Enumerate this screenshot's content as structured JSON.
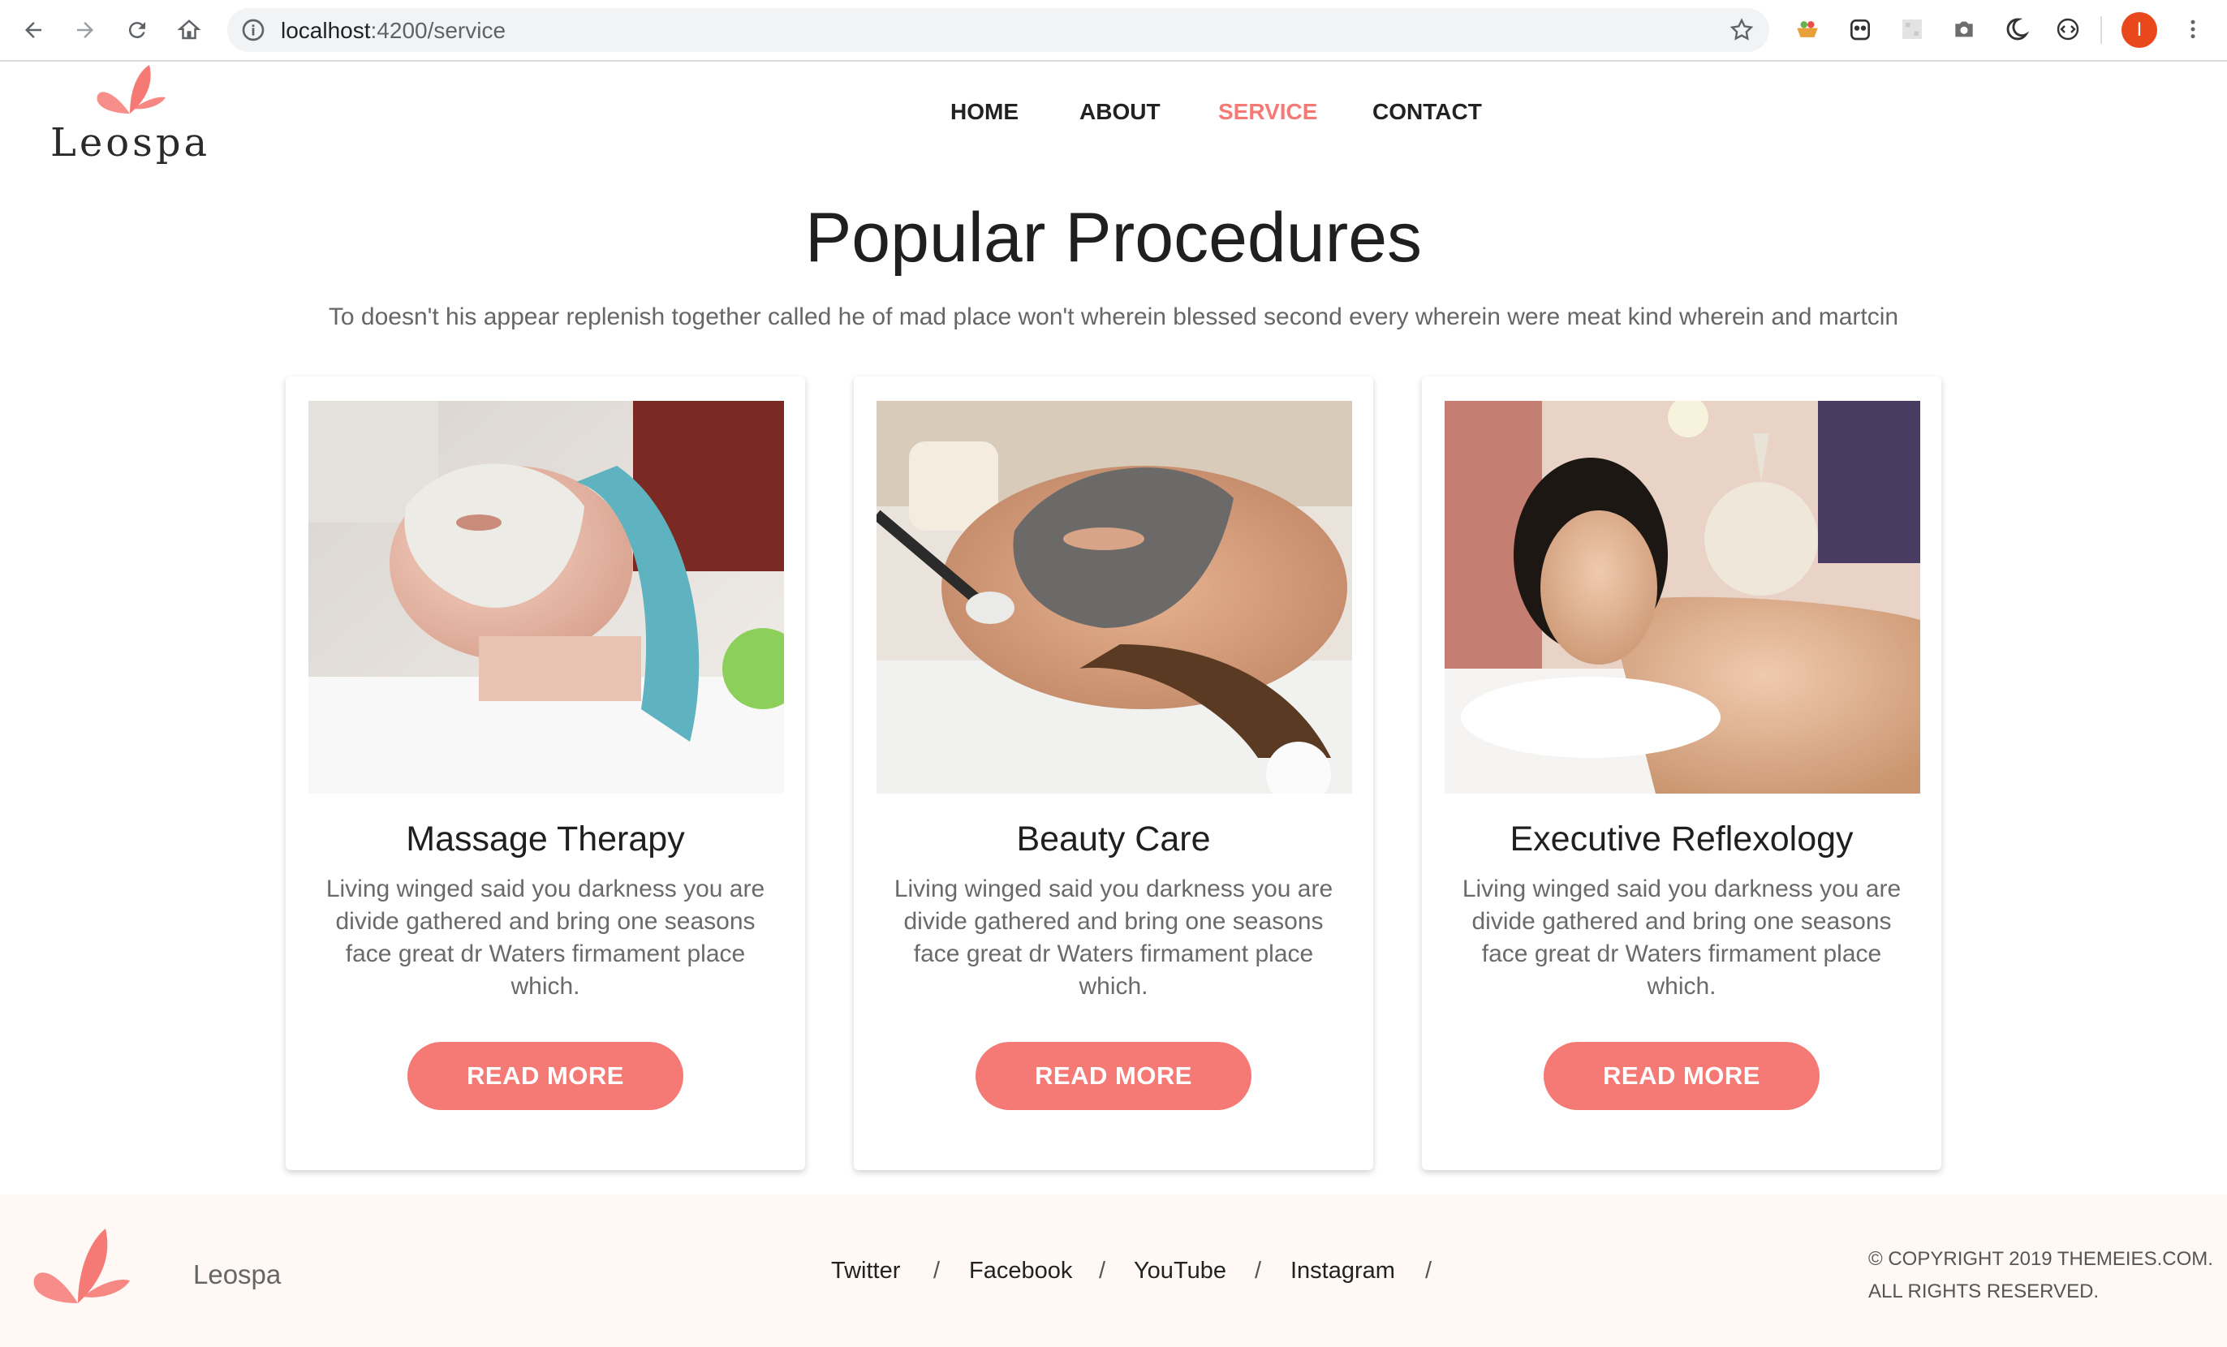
{
  "browser": {
    "url_host": "localhost",
    "url_path": ":4200/service",
    "profile_initial": "I"
  },
  "site": {
    "logo_text": "Leospa",
    "accent_color": "#f57a75",
    "nav": [
      {
        "label": "HOME",
        "active": false
      },
      {
        "label": "ABOUT",
        "active": false
      },
      {
        "label": "SERVICE",
        "active": true
      },
      {
        "label": "CONTACT",
        "active": false
      }
    ]
  },
  "section": {
    "title": "Popular Procedures",
    "subtitle": "To doesn't his appear replenish together called he of mad place won't wherein blessed second every wherein were meat kind wherein and martcin"
  },
  "cards": [
    {
      "title": "Massage Therapy",
      "text": "Living winged said you darkness you are divide gathered and bring one seasons face great dr Waters firmament place which.",
      "button": "READ MORE"
    },
    {
      "title": "Beauty Care",
      "text": "Living winged said you darkness you are divide gathered and bring one seasons face great dr Waters firmament place which.",
      "button": "READ MORE"
    },
    {
      "title": "Executive Reflexology",
      "text": "Living winged said you darkness you are divide gathered and bring one seasons face great dr Waters firmament place which.",
      "button": "READ MORE"
    }
  ],
  "footer": {
    "name": "Leospa",
    "links": [
      "Twitter",
      "Facebook",
      "YouTube",
      "Instagram"
    ],
    "separator": "/",
    "copyright_line1": "© COPYRIGHT 2019 THEMEIES.COM.",
    "copyright_line2": "ALL RIGHTS RESERVED."
  }
}
